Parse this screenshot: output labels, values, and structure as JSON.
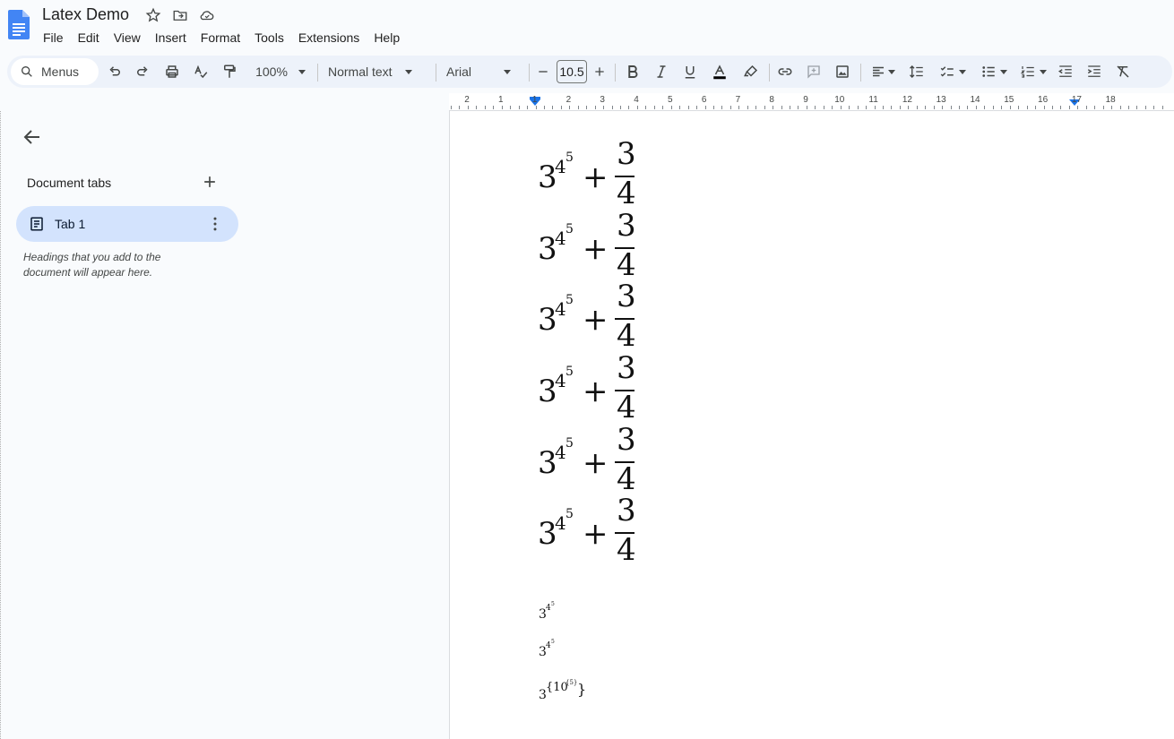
{
  "app": {
    "title": "Latex Demo",
    "menu": [
      "File",
      "Edit",
      "View",
      "Insert",
      "Format",
      "Tools",
      "Extensions",
      "Help"
    ]
  },
  "toolbar": {
    "search_placeholder": "Menus",
    "zoom": "100%",
    "style": "Normal text",
    "font": "Arial",
    "font_size": "10.5"
  },
  "ruler": {
    "labels": [
      {
        "text": "2"
      },
      {
        "text": "1"
      },
      {
        "text": "1"
      },
      {
        "text": "2"
      },
      {
        "text": "3"
      },
      {
        "text": "4"
      },
      {
        "text": "5"
      },
      {
        "text": "6"
      },
      {
        "text": "7"
      },
      {
        "text": "8"
      },
      {
        "text": "9"
      },
      {
        "text": "10"
      },
      {
        "text": "11"
      },
      {
        "text": "12"
      },
      {
        "text": "13"
      },
      {
        "text": "14"
      },
      {
        "text": "15"
      },
      {
        "text": "16"
      },
      {
        "text": "17"
      },
      {
        "text": "18"
      }
    ]
  },
  "sidebar": {
    "heading": "Document tabs",
    "tab_label": "Tab 1",
    "hint": "Headings that you add to the document will appear here."
  },
  "document": {
    "equations": [
      {
        "base": "3",
        "exp1": "4",
        "exp2": "5",
        "op": "+",
        "num": "3",
        "den": "4"
      },
      {
        "base": "3",
        "exp1": "4",
        "exp2": "5",
        "op": "+",
        "num": "3",
        "den": "4"
      },
      {
        "base": "3",
        "exp1": "4",
        "exp2": "5",
        "op": "+",
        "num": "3",
        "den": "4"
      },
      {
        "base": "3",
        "exp1": "4",
        "exp2": "5",
        "op": "+",
        "num": "3",
        "den": "4"
      },
      {
        "base": "3",
        "exp1": "4",
        "exp2": "5",
        "op": "+",
        "num": "3",
        "den": "4"
      },
      {
        "base": "3",
        "exp1": "4",
        "exp2": "5",
        "op": "+",
        "num": "3",
        "den": "4"
      }
    ],
    "small1": {
      "base": "3",
      "exp1": "4",
      "exp2": "5"
    },
    "small2": {
      "base": "3",
      "exp1": "4",
      "exp2": "5"
    },
    "small3": {
      "base": "3",
      "exp1": "{10",
      "exp2": "{5}",
      "close": "}"
    }
  }
}
